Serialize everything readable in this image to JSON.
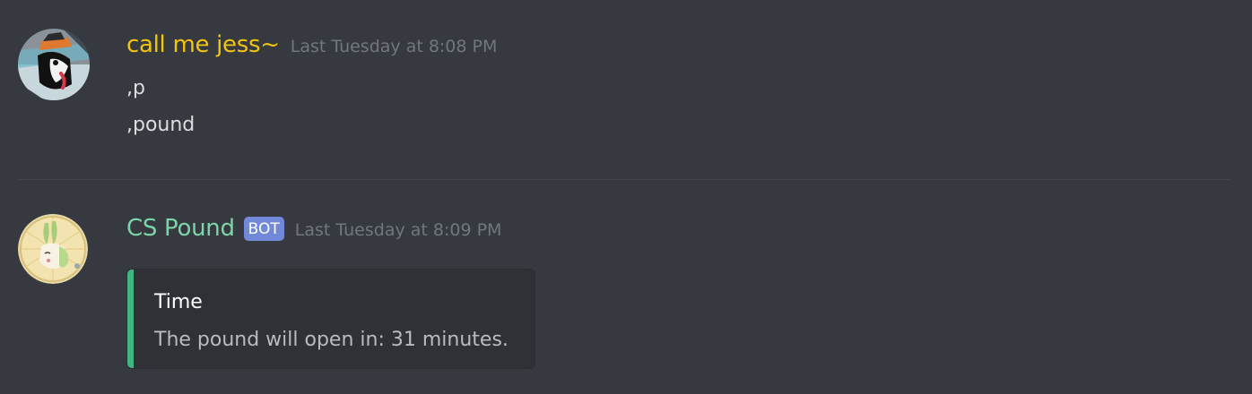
{
  "colors": {
    "background": "#36393f",
    "user1_name": "#f1c40f",
    "bot_name": "#79d6a6",
    "bot_tag": "#7289da",
    "embed_accent": "#43b581",
    "timestamp": "#72767d"
  },
  "messages": [
    {
      "username": "call me jess~",
      "timestamp": "Last Tuesday at 8:08 PM",
      "avatar_icon": "husky-dog-avatar-icon",
      "lines": [
        ",p",
        ",pound"
      ]
    },
    {
      "username": "CS Pound",
      "bot_tag": "BOT",
      "timestamp": "Last Tuesday at 8:09 PM",
      "avatar_icon": "green-bunny-avatar-icon",
      "embed": {
        "title": "Time",
        "description": "The pound will open in: 31 minutes."
      }
    }
  ]
}
